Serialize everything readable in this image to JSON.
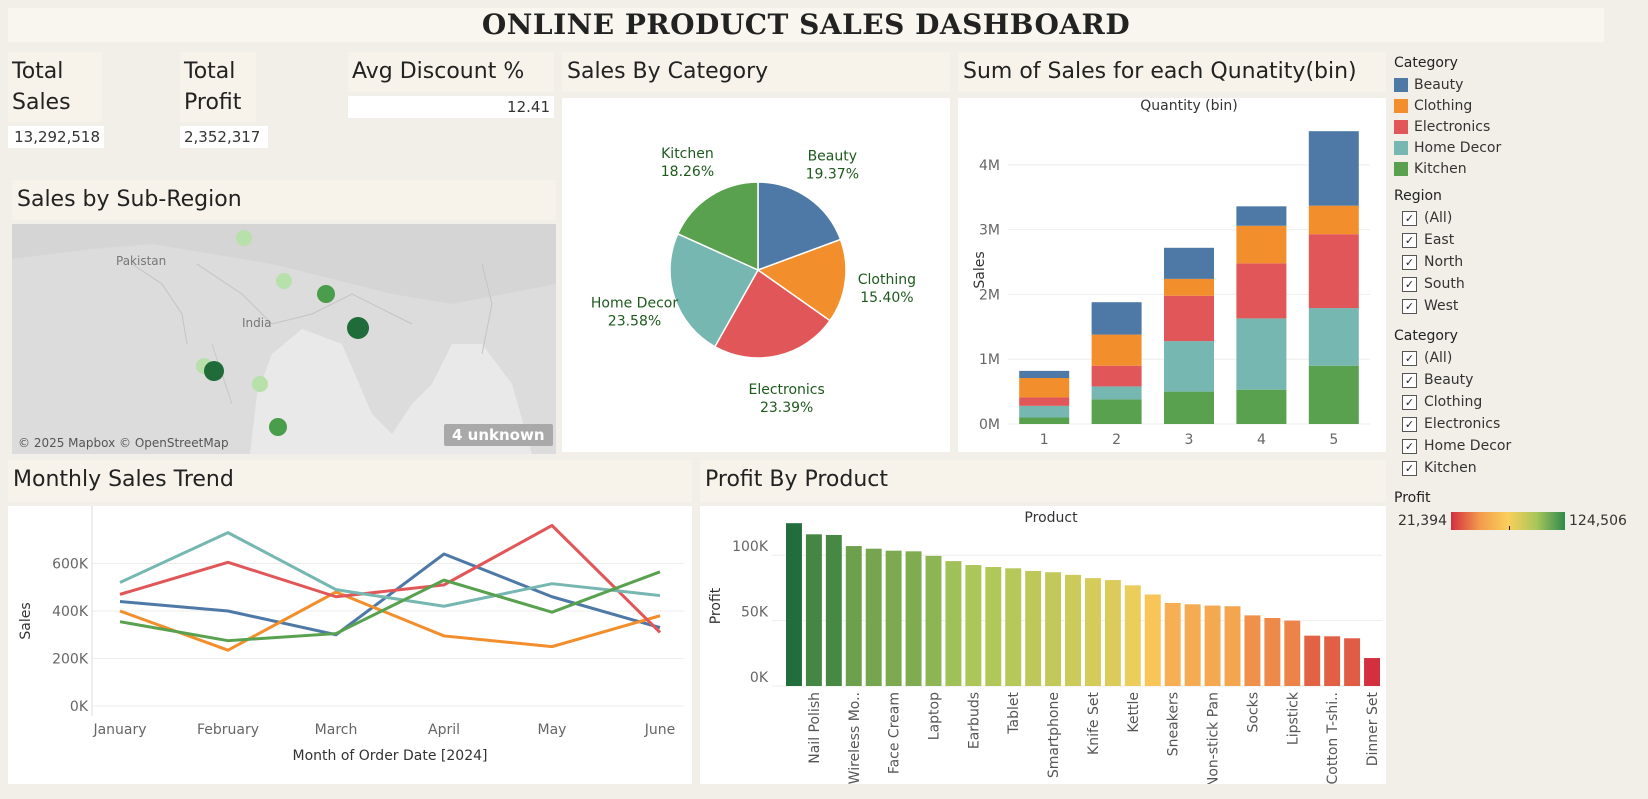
{
  "title": "ONLINE PRODUCT SALES DASHBOARD",
  "kpis": {
    "total_sales": {
      "label": "Total Sales",
      "value": "13,292,518"
    },
    "total_profit": {
      "label": "Total Profit",
      "value": "2,352,317"
    },
    "avg_discount": {
      "label": "Avg Discount %",
      "value": "12.41"
    }
  },
  "map": {
    "title": "Sales by Sub-Region",
    "labels": [
      "Pakistan",
      "India"
    ],
    "attribution": "© 2025 Mapbox © OpenStreetMap",
    "unknown_badge": "4 unknown"
  },
  "colors": {
    "Beauty": "#4e79a7",
    "Clothing": "#f28e2b",
    "Electronics": "#e15759",
    "Home Decor": "#76b7b2",
    "Kitchen": "#59a14f"
  },
  "filters": {
    "category_legend_title": "Category",
    "category_legend": [
      "Beauty",
      "Clothing",
      "Electronics",
      "Home Decor",
      "Kitchen"
    ],
    "region_title": "Region",
    "region_items": [
      "(All)",
      "East",
      "North",
      "South",
      "West"
    ],
    "category_title": "Category",
    "category_items": [
      "(All)",
      "Beauty",
      "Clothing",
      "Electronics",
      "Home Decor",
      "Kitchen"
    ],
    "profit_title": "Profit",
    "profit_min": "21,394",
    "profit_max": "124,506"
  },
  "chart_data": [
    {
      "id": "sales-by-category",
      "type": "pie",
      "title": "Sales By Category",
      "slices": [
        {
          "label": "Beauty",
          "value": 19.37,
          "text": "19.37%"
        },
        {
          "label": "Clothing",
          "value": 15.4,
          "text": "15.40%"
        },
        {
          "label": "Electronics",
          "value": 23.39,
          "text": "23.39%"
        },
        {
          "label": "Home Decor",
          "value": 23.58,
          "text": "23.58%"
        },
        {
          "label": "Kitchen",
          "value": 18.26,
          "text": "18.26%"
        }
      ]
    },
    {
      "id": "sales-by-quantity-bin",
      "type": "bar",
      "stacked": true,
      "title": "Sum of Sales for each Qunatity(bin)",
      "xlabel": "Quantity (bin)",
      "ylabel": "Sales",
      "categories": [
        "1",
        "2",
        "3",
        "4",
        "5"
      ],
      "ylim": [
        0,
        4600000
      ],
      "yticks": [
        {
          "v": 0,
          "label": "0M"
        },
        {
          "v": 1000000,
          "label": "1M"
        },
        {
          "v": 2000000,
          "label": "2M"
        },
        {
          "v": 3000000,
          "label": "3M"
        },
        {
          "v": 4000000,
          "label": "4M"
        }
      ],
      "series": [
        {
          "name": "Kitchen",
          "values": [
            100000,
            380000,
            500000,
            530000,
            900000
          ]
        },
        {
          "name": "Home Decor",
          "values": [
            180000,
            200000,
            780000,
            1100000,
            890000
          ]
        },
        {
          "name": "Electronics",
          "values": [
            130000,
            320000,
            700000,
            850000,
            1140000
          ]
        },
        {
          "name": "Clothing",
          "values": [
            300000,
            480000,
            260000,
            580000,
            440000
          ]
        },
        {
          "name": "Beauty",
          "values": [
            110000,
            500000,
            480000,
            300000,
            1150000
          ]
        }
      ]
    },
    {
      "id": "monthly-sales-trend",
      "type": "line",
      "title": "Monthly Sales Trend",
      "xlabel": "Month of Order Date [2024]",
      "ylabel": "Sales",
      "categories": [
        "January",
        "February",
        "March",
        "April",
        "May",
        "June"
      ],
      "ylim": [
        0,
        800000
      ],
      "yticks": [
        {
          "v": 0,
          "label": "0K"
        },
        {
          "v": 200000,
          "label": "200K"
        },
        {
          "v": 400000,
          "label": "400K"
        },
        {
          "v": 600000,
          "label": "600K"
        }
      ],
      "series": [
        {
          "name": "Beauty",
          "values": [
            440000,
            400000,
            300000,
            640000,
            460000,
            330000
          ]
        },
        {
          "name": "Clothing",
          "values": [
            400000,
            235000,
            480000,
            295000,
            250000,
            380000
          ]
        },
        {
          "name": "Electronics",
          "values": [
            470000,
            605000,
            460000,
            510000,
            760000,
            310000
          ]
        },
        {
          "name": "Home Decor",
          "values": [
            520000,
            730000,
            490000,
            420000,
            515000,
            465000
          ]
        },
        {
          "name": "Kitchen",
          "values": [
            355000,
            275000,
            305000,
            530000,
            395000,
            565000
          ]
        }
      ]
    },
    {
      "id": "profit-by-product",
      "type": "bar",
      "title": "Profit By Product",
      "xlabel": "Product",
      "ylabel": "Profit",
      "ylim": [
        0,
        130000
      ],
      "yticks": [
        {
          "v": 0,
          "label": "0K"
        },
        {
          "v": 50000,
          "label": "50K"
        },
        {
          "v": 100000,
          "label": "100K"
        }
      ],
      "color_range": [
        21394,
        124506
      ],
      "bars": [
        {
          "label": "",
          "value": 124506
        },
        {
          "label": "Nail Polish",
          "value": 116000
        },
        {
          "label": "",
          "value": 115500
        },
        {
          "label": "Wireless Mo..",
          "value": 107000
        },
        {
          "label": "",
          "value": 105000
        },
        {
          "label": "Face Cream",
          "value": 103500
        },
        {
          "label": "",
          "value": 103000
        },
        {
          "label": "Laptop",
          "value": 99500
        },
        {
          "label": "",
          "value": 95500
        },
        {
          "label": "Earbuds",
          "value": 92500
        },
        {
          "label": "",
          "value": 91000
        },
        {
          "label": "Tablet",
          "value": 90000
        },
        {
          "label": "",
          "value": 88000
        },
        {
          "label": "Smartphone",
          "value": 87000
        },
        {
          "label": "",
          "value": 85000
        },
        {
          "label": "Knife Set",
          "value": 82500
        },
        {
          "label": "",
          "value": 81000
        },
        {
          "label": "Kettle",
          "value": 77000
        },
        {
          "label": "",
          "value": 70000
        },
        {
          "label": "Sneakers",
          "value": 63500
        },
        {
          "label": "",
          "value": 62500
        },
        {
          "label": "Non-stick Pan",
          "value": 61500
        },
        {
          "label": "",
          "value": 61000
        },
        {
          "label": "Socks",
          "value": 54000
        },
        {
          "label": "",
          "value": 52000
        },
        {
          "label": "Lipstick",
          "value": 50000
        },
        {
          "label": "",
          "value": 38500
        },
        {
          "label": "Cotton T-shi..",
          "value": 38000
        },
        {
          "label": "",
          "value": 36500
        },
        {
          "label": "Dinner Set",
          "value": 21394
        }
      ]
    }
  ]
}
